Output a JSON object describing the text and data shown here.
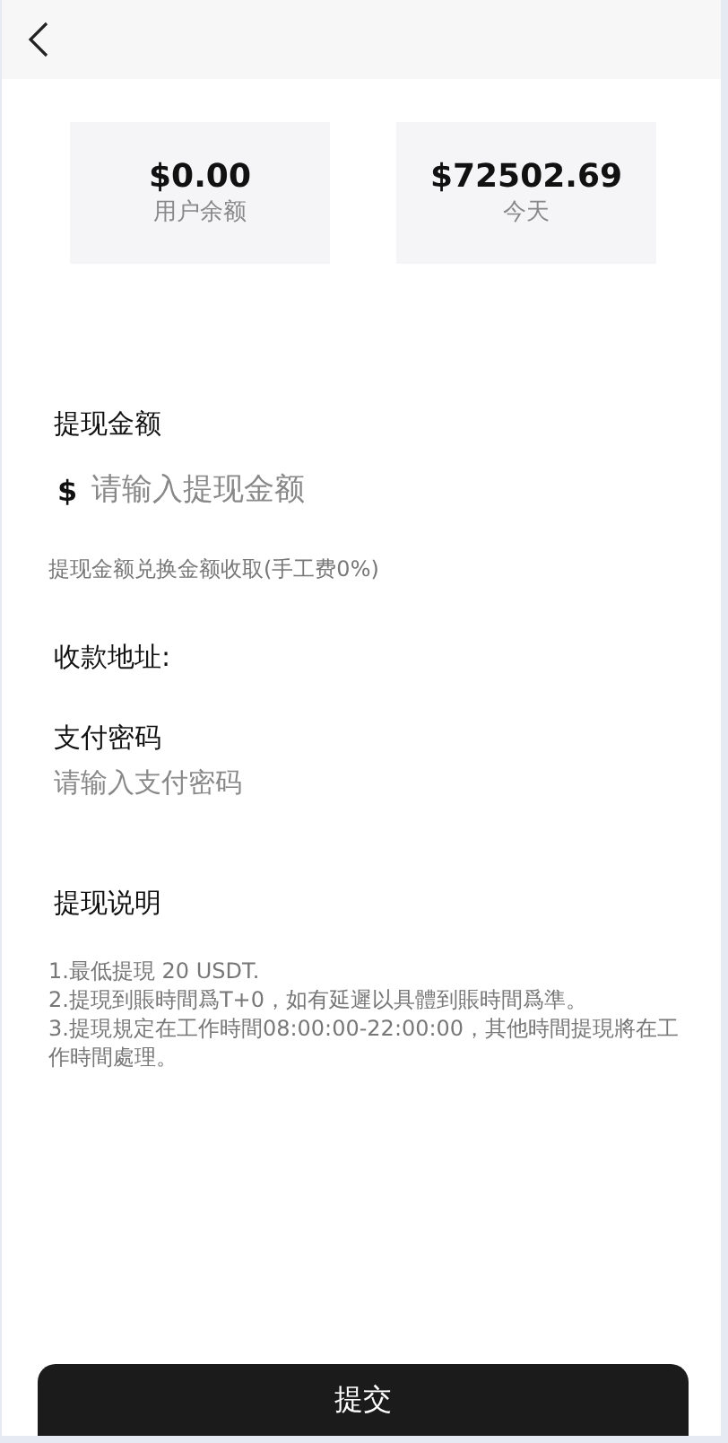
{
  "header": {
    "back": true
  },
  "stats": [
    {
      "value": "$0.00",
      "label": "用户余额"
    },
    {
      "value": "$72502.69",
      "label": "今天"
    }
  ],
  "amount": {
    "label": "提现金额",
    "currency": "$",
    "placeholder": "请输入提现金额",
    "hint": "提现金额兑换金额收取(手工费0%)"
  },
  "address": {
    "label": "收款地址:"
  },
  "password": {
    "label": "支付密码",
    "placeholder": "请输入支付密码"
  },
  "notes": {
    "title": "提现说明",
    "lines": [
      "1.最低提現 20 USDT.",
      "2.提現到賬時間爲T+0，如有延遲以具體到賬時間爲準。",
      "3.提現規定在工作時間08:00:00-22:00:00，其他時間提現將在工作時間處理。"
    ]
  },
  "submit": "提交"
}
